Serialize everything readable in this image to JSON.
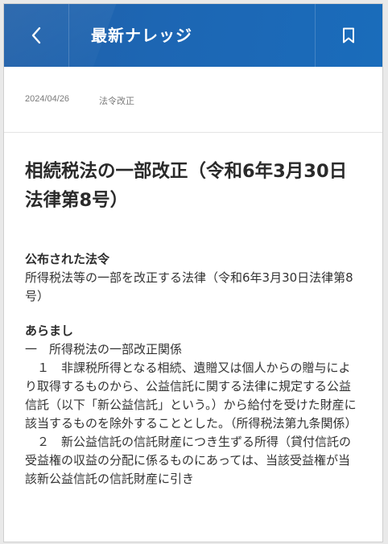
{
  "header": {
    "back_icon": "chevron-left-icon",
    "title": "最新ナレッジ",
    "bookmark_icon": "bookmark-icon",
    "color": "#1d64b0"
  },
  "meta": {
    "date": "2024/04/26",
    "category": "法令改正"
  },
  "article": {
    "headline": "相続税法の一部改正（令和6年3月30日法律第8号）",
    "promulgated_heading": "公布された法令",
    "promulgated_text": "所得税法等の一部を改正する法律（令和6年3月30日法律第8号）",
    "summary_heading": "あらまし",
    "summary_lines": [
      "一　所得税法の一部改正関係",
      "　１　非課税所得となる相続、遺贈又は個人からの贈与により取得するものから、公益信託に関する法律に規定する公益信託（以下「新公益信託」という。）から給付を受けた財産に該当するものを除外することとした。（所得税法第九条関係）",
      "　２　新公益信託の信託財産につき生ずる所得（貸付信託の受益権の収益の分配に係るものにあっては、当該受益権が当該新公益信託の信託財産に引き"
    ]
  }
}
